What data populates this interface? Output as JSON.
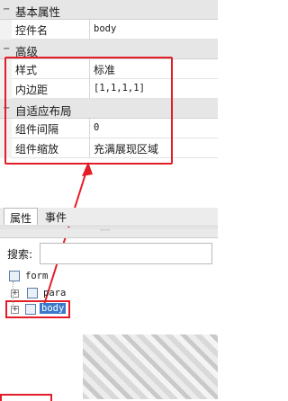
{
  "property_grid": {
    "categories": [
      {
        "title": "基本属性",
        "toggle": "−"
      },
      {
        "title": "高级",
        "toggle": "−"
      },
      {
        "title": "自适应布局",
        "toggle": "−"
      }
    ],
    "basic": [
      {
        "name": "控件名",
        "value": "body"
      }
    ],
    "advanced": [
      {
        "name": "样式",
        "value": "标准"
      },
      {
        "name": "内边距",
        "value": "[1,1,1,1]"
      }
    ],
    "adaptive": [
      {
        "name": "组件间隔",
        "value": "0"
      },
      {
        "name": "组件缩放",
        "value": "充满展现区域"
      }
    ]
  },
  "tabs": [
    {
      "label": "属性",
      "active": true
    },
    {
      "label": "事件",
      "active": false
    }
  ],
  "splitter": {
    "grip": "····"
  },
  "tree": {
    "search_label": "搜索:",
    "search_value": "",
    "nodes": [
      {
        "label": "form",
        "level": 0,
        "expander": ""
      },
      {
        "label": "para",
        "level": 1,
        "expander": "+"
      },
      {
        "label": "body",
        "level": 1,
        "expander": "+",
        "selected": true
      }
    ]
  },
  "colors": {
    "highlight_red": "#e31d27",
    "selection_blue": "#3a78c9"
  }
}
